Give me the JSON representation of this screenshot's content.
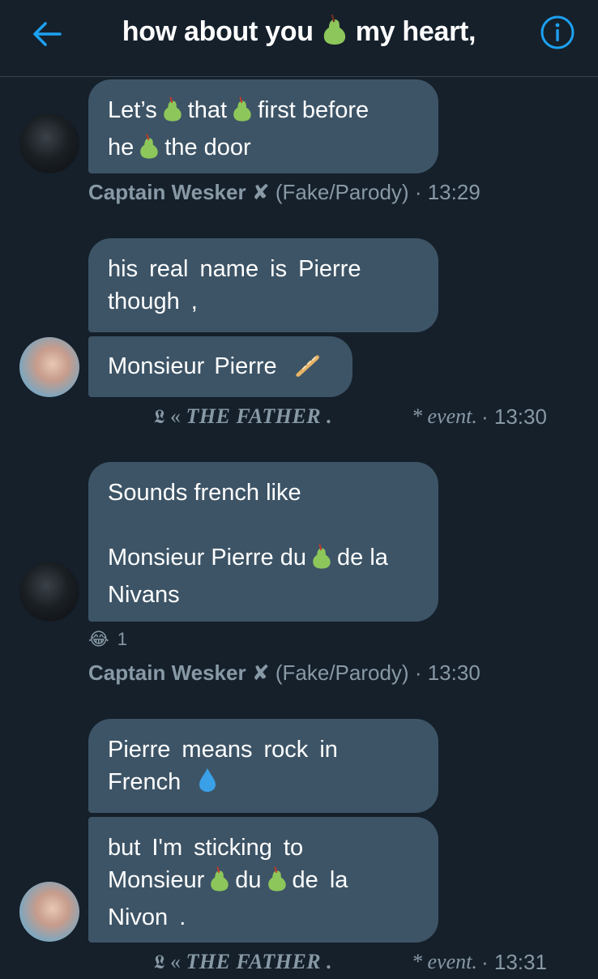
{
  "header": {
    "title_part1": "how about you",
    "title_part2": "my heart,",
    "back_icon": "arrow-left-icon",
    "info_icon": "info-circle-icon",
    "accent_color": "#1da1f2"
  },
  "messages": [
    {
      "sender": "wesker",
      "lines": [
        "Let’s",
        "that",
        "first before",
        "he",
        "the door"
      ]
    },
    {
      "sender": "father",
      "text": "his real name is Pierre though ,"
    },
    {
      "sender": "father",
      "text": "Monsieur Pierre"
    },
    {
      "sender": "wesker",
      "line1": "Sounds french like",
      "line2a": "Monsieur Pierre du",
      "line2b": "de la",
      "line3": "Nivans"
    },
    {
      "sender": "father",
      "line1": "Pierre means rock in",
      "line2": "French"
    },
    {
      "sender": "father",
      "line1": "but I'm sticking to",
      "line2a": "Monsieur",
      "line2b": "du",
      "line2c": "de la",
      "line3": "Nivon ."
    }
  ],
  "meta_wesker_1": {
    "name": "Captain Wesker",
    "badge": "✘",
    "tag": "(Fake/Parody)",
    "time": "· 13:29"
  },
  "meta_wesker_2": {
    "name": "Captain Wesker",
    "badge": "✘",
    "tag": "(Fake/Parody)",
    "time": "· 13:30"
  },
  "meta_father_1": {
    "glyph": "𝕷",
    "quote": "«",
    "name": "THE FATHER .",
    "event": "* event.",
    "time": "· 13:30"
  },
  "meta_father_2": {
    "glyph": "𝕷",
    "quote": "«",
    "name": "THE FATHER .",
    "event": "* event.",
    "time": "· 13:31"
  },
  "reaction": {
    "emoji": "😂",
    "count": "1"
  }
}
